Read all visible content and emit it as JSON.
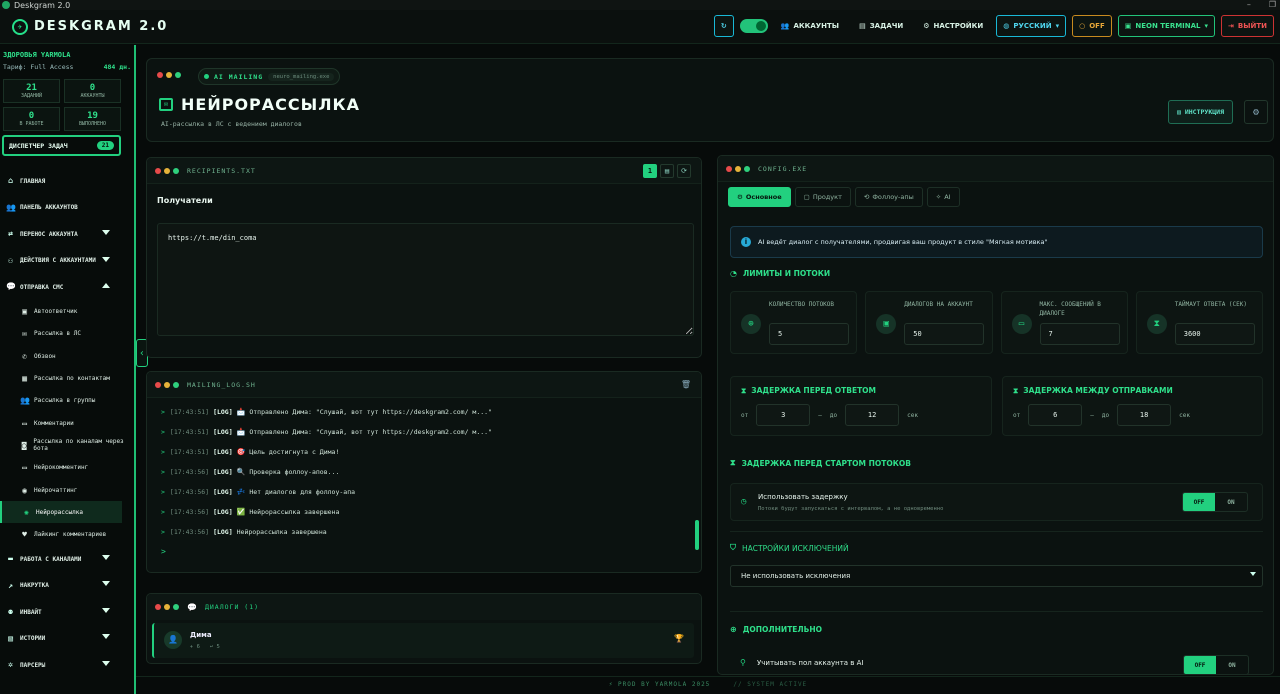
{
  "os": {
    "title": "Deskgram 2.0"
  },
  "brand": {
    "name": "DESKGRAM 2.0"
  },
  "topbar": {
    "accounts": "АККАУНТЫ",
    "tasks": "ЗАДАЧИ",
    "settings": "НАСТРОЙКИ",
    "language": "РУССКИЙ",
    "off": "OFF",
    "theme": "NEON TERMINAL",
    "logout": "ВЫЙТИ"
  },
  "user": {
    "name": "ЗДОРОВЬЯ YARMOLA",
    "plan_label": "Тариф: Full Access",
    "days": "484 дн."
  },
  "stats": [
    {
      "value": "21",
      "label": "ЗАДАНИЙ"
    },
    {
      "value": "0",
      "label": "АККАУНТЫ"
    },
    {
      "value": "0",
      "label": "В РАБОТЕ"
    },
    {
      "value": "19",
      "label": "ВЫПОЛНЕНО"
    }
  ],
  "dispatcher": {
    "label": "ДИСПЕТЧЕР ЗАДАЧ",
    "count": "21"
  },
  "nav": {
    "main": "ГЛАВНАЯ",
    "accounts_panel": "ПАНЕЛЬ АККАУНТОВ",
    "transfer": "ПЕРЕНОС АККАУНТА",
    "actions": "ДЕЙСТВИЯ С АККАУНТАМИ",
    "sms": "ОТПРАВКА СМС",
    "channels": "РАБОТА С КАНАЛАМИ",
    "boost": "НАКРУТКА",
    "invite": "ИНВАЙТ",
    "stories": "ИСТОРИИ",
    "parsers": "ПАРСЕРЫ"
  },
  "subnav": {
    "autoreply": "Автоответчик",
    "dm": "Рассылка в ЛС",
    "calls": "Обзвон",
    "contacts": "Рассылка по контактам",
    "groups": "Рассылка в группы",
    "comments": "Комментарии",
    "bot_channels": "Рассылка по каналам через бота",
    "neurocomment": "Нейрокомментинг",
    "neurochat": "Нейрочаттинг",
    "neuromail": "Нейрорассылка",
    "likes": "Лайкинг комментариев"
  },
  "hero": {
    "tag": "AI MAILING",
    "file": "neuro_mailing.exe",
    "title": "НЕЙРОРАССЫЛКА",
    "subtitle": "AI-рассылка в ЛС с ведением диалогов",
    "instructions": "ИНСТРУКЦИЯ"
  },
  "recipients": {
    "file": "RECIPIENTS.TXT",
    "page": "1",
    "label": "Получатели",
    "value": "https://t.me/din_coma"
  },
  "log": {
    "file": "MAILING_LOG.SH",
    "lines": [
      {
        "ts": "[17:43:51]",
        "tag": "[LOG]",
        "icon": "📩",
        "text": "Отправлено Дима: \"Слушай, вот тут https://deskgram2.com/ м...\""
      },
      {
        "ts": "[17:43:51]",
        "tag": "[LOG]",
        "icon": "📩",
        "text": "Отправлено Дима: \"Слушай, вот тут https://deskgram2.com/ м...\""
      },
      {
        "ts": "[17:43:51]",
        "tag": "[LOG]",
        "icon": "🎯",
        "text": "Цель достигнута с Дима!"
      },
      {
        "ts": "[17:43:56]",
        "tag": "[LOG]",
        "icon": "🔍",
        "text": "Проверка фоллоу-апов..."
      },
      {
        "ts": "[17:43:56]",
        "tag": "[LOG]",
        "icon": "💤",
        "text": "Нет диалогов для фоллоу-апа"
      },
      {
        "ts": "[17:43:56]",
        "tag": "[LOG]",
        "icon": "✅",
        "text": "Нейрорассылка завершена"
      },
      {
        "ts": "[17:43:56]",
        "tag": "[LOG]",
        "icon": "",
        "text": "Нейрорассылка завершена"
      }
    ],
    "prompt": ">"
  },
  "dialogs": {
    "title": "ДИАЛОГИ (1)",
    "items": [
      {
        "name": "Дима",
        "sent": "6",
        "recv": "5"
      }
    ]
  },
  "config": {
    "file": "CONFIG.EXE",
    "tabs": [
      "Основное",
      "Продукт",
      "Фоллоу-апы",
      "AI"
    ],
    "info": "AI ведёт диалог с получателями, продвигая ваш продукт в стиле \"Мягкая мотивка\"",
    "limits_title": "ЛИМИТЫ И ПОТОКИ",
    "limits": [
      {
        "label": "КОЛИЧЕСТВО ПОТОКОВ",
        "value": "5"
      },
      {
        "label": "ДИАЛОГОВ НА АККАУНТ",
        "value": "50"
      },
      {
        "label": "МАКС. СООБЩЕНИЙ В ДИАЛОГЕ",
        "value": "7"
      },
      {
        "label": "ТАЙМАУТ ОТВЕТА (СЕК)",
        "value": "3600"
      }
    ],
    "reply_delay": {
      "title": "ЗАДЕРЖКА ПЕРЕД ОТВЕТОМ",
      "from": "от",
      "min": "3",
      "to": "до",
      "max": "12",
      "unit": "сек"
    },
    "send_delay": {
      "title": "ЗАДЕРЖКА МЕЖДУ ОТПРАВКАМИ",
      "from": "от",
      "min": "6",
      "to": "до",
      "max": "18",
      "unit": "сек"
    },
    "start_delay": {
      "title": "ЗАДЕРЖКА ПЕРЕД СТАРТОМ ПОТОКОВ",
      "label": "Использовать задержку",
      "hint": "Потоки будут запускаться с интервалом, а не одновременно",
      "off": "OFF",
      "on": "ON"
    },
    "exclusions": {
      "title": "НАСТРОЙКИ ИСКЛЮЧЕНИЙ",
      "value": "Не использовать исключения"
    },
    "extra": {
      "title": "ДОПОЛНИТЕЛЬНО",
      "gender": "Учитывать пол аккаунта в AI",
      "off": "OFF",
      "on": "ON"
    }
  },
  "footer": {
    "credit": "⚡ PROD BY YARMOLA 2025",
    "status": "// SYSTEM ACTIVE"
  },
  "colors": {
    "accent": "#22d07f",
    "cyan": "#19b8d6",
    "orange": "#c78a1f",
    "red": "#cc3333"
  }
}
